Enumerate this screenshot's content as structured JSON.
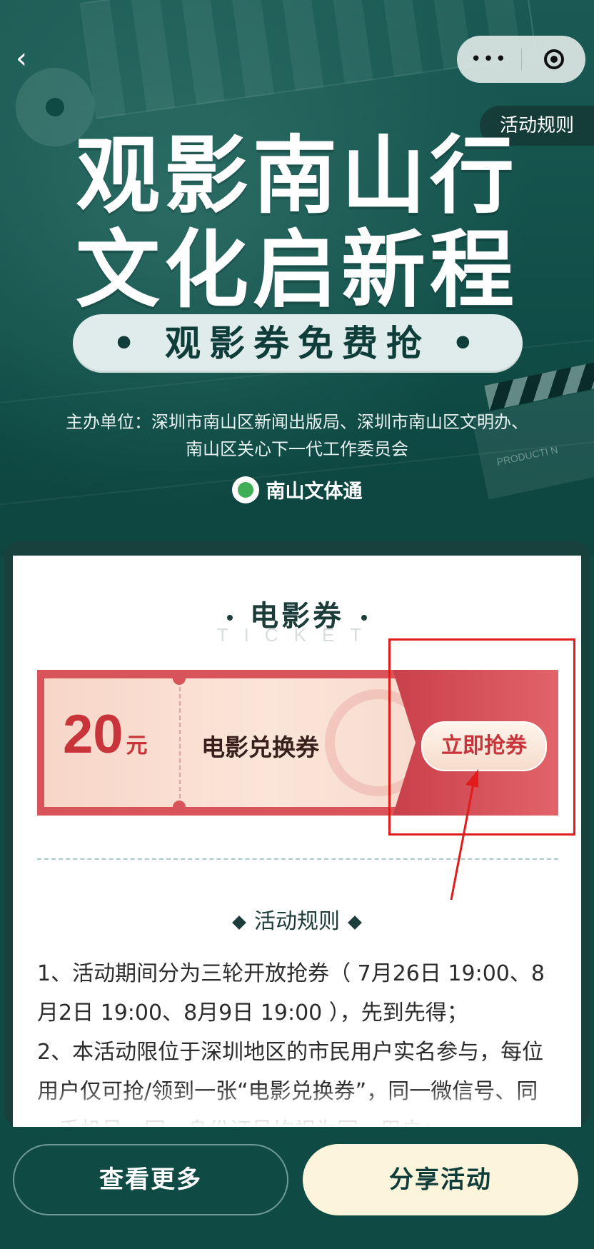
{
  "top": {
    "back_glyph": "‹",
    "more_glyph": "•••",
    "rules_tab": "活动规则"
  },
  "hero": {
    "title_line1": "观影南山行",
    "title_line2": "文化启新程",
    "subtitle": "• 观影券免费抢 •",
    "organizer_line1": "主办单位：深圳市南山区新闻出版局、深圳市南山区文明办、",
    "organizer_line2": "南山区关心下一代工作委员会",
    "brand": "南山文体通",
    "clapper_text": "PRODUCTI N"
  },
  "card": {
    "title": "电影券",
    "subtitle": "TICKET",
    "coupon": {
      "price": "20",
      "unit": "元",
      "name": "电影兑换券",
      "grab_label": "立即抢券"
    },
    "rules_title": "活动规则",
    "rules": [
      "1、活动期间分为三轮开放抢券（ 7月26日 19:00、8月2日 19:00、8月9日 19:00 ），先到先得；",
      "2、本活动限位于深圳地区的市民用户实名参与，每位用户仅可抢/领到一张“电影兑换券”，同一微信号、同一手机号、同一身份证号均视为同一用户；"
    ]
  },
  "bottom": {
    "more_label": "查看更多",
    "share_label": "分享活动"
  },
  "colors": {
    "bg": "#0f4a45",
    "coupon_red": "#d8545a",
    "highlight_box": "#e21b1b",
    "share_bg": "#fdf4dc"
  }
}
